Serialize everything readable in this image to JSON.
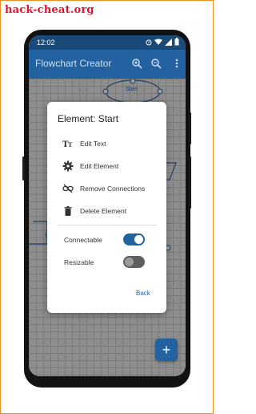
{
  "watermark": {
    "text": "hack-cheat.org"
  },
  "statusbar": {
    "time": "12:02"
  },
  "appbar": {
    "title": "Flowchart Creator",
    "icons": [
      "zoom-in-icon",
      "zoom-out-icon",
      "more-vert-icon"
    ]
  },
  "canvas": {
    "start_shape_label": "Start",
    "partial_label": "U"
  },
  "dialog": {
    "title": "Element: Start",
    "menu": [
      {
        "icon": "text-format-icon",
        "label": "Edit Text"
      },
      {
        "icon": "gear-icon",
        "label": "Edit Element"
      },
      {
        "icon": "link-off-icon",
        "label": "Remove Connections"
      },
      {
        "icon": "trash-icon",
        "label": "Delete Element"
      }
    ],
    "toggles": [
      {
        "label": "Connectable",
        "state": "on"
      },
      {
        "label": "Resizable",
        "state": "off"
      }
    ],
    "back_label": "Back"
  },
  "fab": {
    "symbol": "+"
  },
  "colors": {
    "primary": "#2362a1",
    "statusbar": "#1c4a78",
    "frame_border": "#f08c1c",
    "watermark": "#e8112d",
    "switch_on": "#2362a1",
    "switch_off": "#5f5f5f"
  }
}
